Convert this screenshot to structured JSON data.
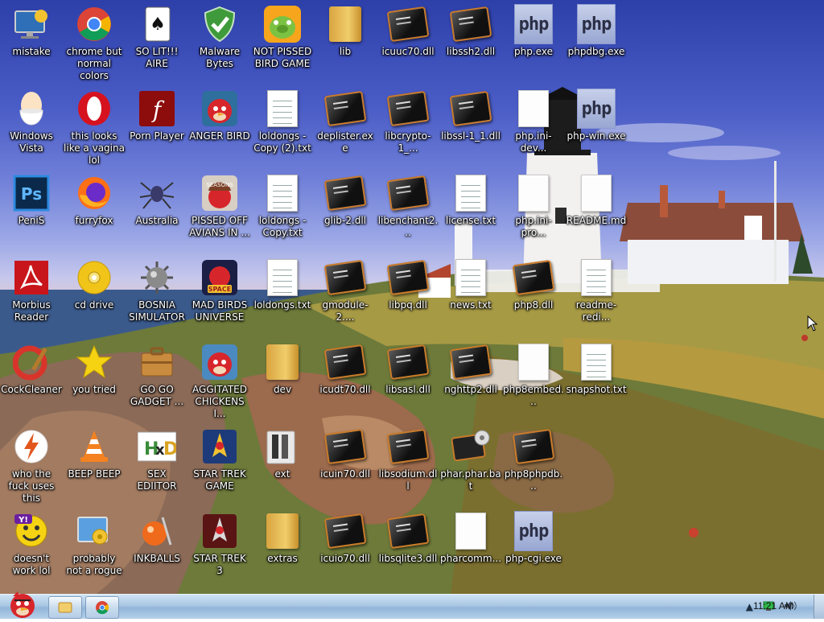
{
  "desktop": {
    "icons": [
      {
        "label": "mistake",
        "icon": "monitor-icon"
      },
      {
        "label": "chrome but normal colors",
        "icon": "chrome-icon"
      },
      {
        "label": "SO LIT!!! AIRE",
        "icon": "solitaire-icon"
      },
      {
        "label": "Malware Bytes",
        "icon": "shield-icon"
      },
      {
        "label": "NOT PISSED BIRD GAME",
        "icon": "angry-birds-pig-icon"
      },
      {
        "label": "lib",
        "icon": "folder-icon"
      },
      {
        "label": "icuuc70.dll",
        "icon": "dll-icon"
      },
      {
        "label": "libssh2.dll",
        "icon": "dll-icon"
      },
      {
        "label": "php.exe",
        "icon": "php-icon"
      },
      {
        "label": "phpdbg.exe",
        "icon": "php-icon"
      },
      {
        "label": "Windows Vista",
        "icon": "egg-icon"
      },
      {
        "label": "this looks like a vagina lol",
        "icon": "opera-icon"
      },
      {
        "label": "Porn Player",
        "icon": "flash-icon"
      },
      {
        "label": "ANGER BIRD",
        "icon": "angry-bird-icon"
      },
      {
        "label": "loldongs - Copy (2).txt",
        "icon": "text-file-icon"
      },
      {
        "label": "deplister.exe",
        "icon": "dll-icon"
      },
      {
        "label": "libcrypto-1_...",
        "icon": "dll-icon"
      },
      {
        "label": "libssl-1_1.dll",
        "icon": "dll-icon"
      },
      {
        "label": "php.ini-dev...",
        "icon": "blank-file-icon"
      },
      {
        "label": "php-win.exe",
        "icon": "php-icon"
      },
      {
        "label": "PeniS",
        "icon": "photoshop-icon"
      },
      {
        "label": "furryfox",
        "icon": "firefox-icon"
      },
      {
        "label": "Australia",
        "icon": "spider-solitaire-icon"
      },
      {
        "label": "PISSED OFF AVIANS IN ...",
        "icon": "angry-birds-seasons-icon"
      },
      {
        "label": "loldongs - Copy.txt",
        "icon": "text-file-icon"
      },
      {
        "label": "glib-2.dll",
        "icon": "dll-icon"
      },
      {
        "label": "libenchant2...",
        "icon": "dll-icon"
      },
      {
        "label": "license.txt",
        "icon": "text-file-icon"
      },
      {
        "label": "php.ini-pro...",
        "icon": "blank-file-icon"
      },
      {
        "label": "README.md",
        "icon": "blank-file-icon"
      },
      {
        "label": "Morbius Reader",
        "icon": "acrobat-icon"
      },
      {
        "label": "cd drive",
        "icon": "cd-icon"
      },
      {
        "label": "BOSNIA SIMULATOR",
        "icon": "mine-icon"
      },
      {
        "label": "MAD BIRDS UNIVERSE",
        "icon": "angry-birds-space-icon"
      },
      {
        "label": "loldongs.txt",
        "icon": "text-file-icon"
      },
      {
        "label": "gmodule-2....",
        "icon": "dll-icon"
      },
      {
        "label": "libpq.dll",
        "icon": "dll-icon"
      },
      {
        "label": "news.txt",
        "icon": "text-file-icon"
      },
      {
        "label": "php8.dll",
        "icon": "dll-icon"
      },
      {
        "label": "readme-redi...",
        "icon": "text-file-icon"
      },
      {
        "label": "CockCleaner",
        "icon": "ccleaner-icon"
      },
      {
        "label": "you tried",
        "icon": "star-icon"
      },
      {
        "label": "GO GO GADGET ...",
        "icon": "briefcase-icon"
      },
      {
        "label": "AGGITATED CHICKENS I...",
        "icon": "angry-bird-icon"
      },
      {
        "label": "dev",
        "icon": "folder-icon"
      },
      {
        "label": "icudt70.dll",
        "icon": "dll-icon"
      },
      {
        "label": "libsasl.dll",
        "icon": "dll-icon"
      },
      {
        "label": "nghttp2.dll",
        "icon": "dll-icon"
      },
      {
        "label": "php8embed...",
        "icon": "blank-file-icon"
      },
      {
        "label": "snapshot.txt",
        "icon": "text-file-icon"
      },
      {
        "label": "who the fuck uses this",
        "icon": "winamp-icon"
      },
      {
        "label": "BEEP BEEP",
        "icon": "vlc-icon"
      },
      {
        "label": "SEX EDIITOR",
        "icon": "hxd-icon"
      },
      {
        "label": "STAR TREK GAME",
        "icon": "star-trek-icon"
      },
      {
        "label": "ext",
        "icon": "folder-icon"
      },
      {
        "label": "icuin70.dll",
        "icon": "dll-icon"
      },
      {
        "label": "libsodium.dll",
        "icon": "dll-icon"
      },
      {
        "label": "phar.phar.bat",
        "icon": "batch-file-icon"
      },
      {
        "label": "php8phpdb...",
        "icon": "dll-icon"
      },
      {
        "label": "doesn't work lol",
        "icon": "yahoo-messenger-icon"
      },
      {
        "label": "probably not a rogue",
        "icon": "control-panel-icon"
      },
      {
        "label": "INKBALLS",
        "icon": "inkball-icon"
      },
      {
        "label": "STAR TREK 3",
        "icon": "star-trek-icon"
      },
      {
        "label": "extras",
        "icon": "folder-icon"
      },
      {
        "label": "icuio70.dll",
        "icon": "dll-icon"
      },
      {
        "label": "libsqlite3.dll",
        "icon": "dll-icon"
      },
      {
        "label": "pharcomm...",
        "icon": "blank-file-icon"
      },
      {
        "label": "php-cgi.exe",
        "icon": "php-icon"
      }
    ]
  },
  "taskbar": {
    "start_icon": "angry-bird-icon",
    "pinned": [
      {
        "icon": "folder-icon"
      },
      {
        "icon": "chrome-icon"
      }
    ],
    "tray": {
      "icons": [
        "show-hidden-icons",
        "network-icon",
        "volume-icon"
      ]
    },
    "clock": "11:21 AM"
  },
  "colors": {
    "taskbar": "#a9c7e4",
    "label_text": "#ffffff",
    "dll_border": "#c87a2a"
  }
}
